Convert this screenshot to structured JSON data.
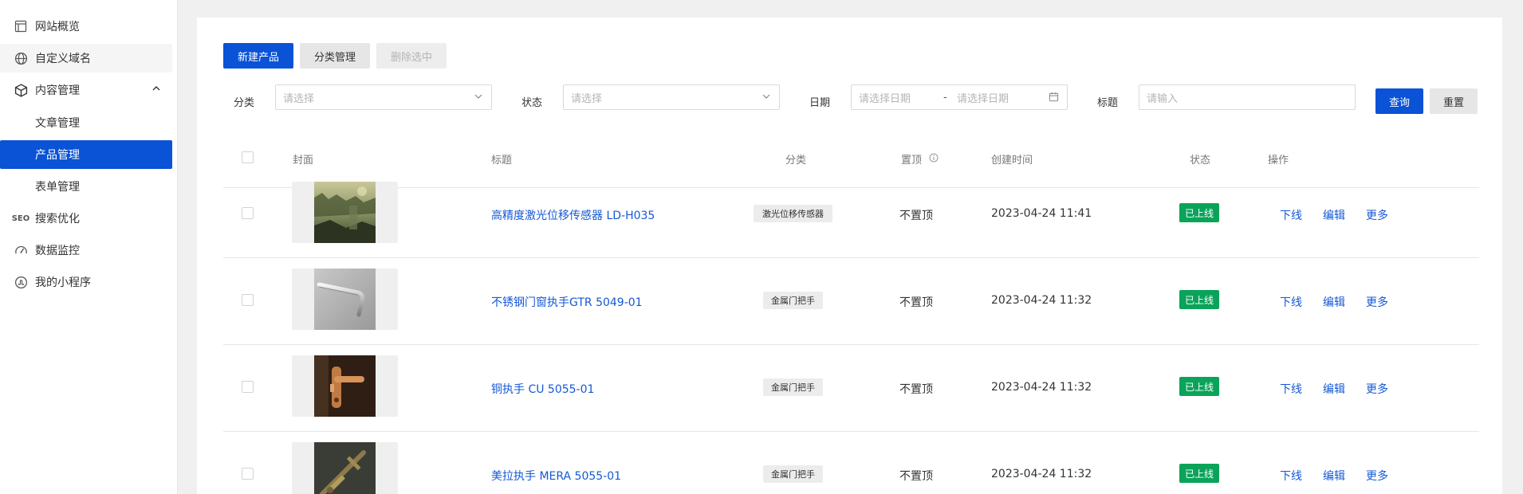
{
  "sidebar": {
    "items": [
      {
        "label": "网站概览"
      },
      {
        "label": "自定义域名"
      },
      {
        "label": "内容管理"
      },
      {
        "label": "文章管理"
      },
      {
        "label": "产品管理"
      },
      {
        "label": "表单管理"
      },
      {
        "label": "搜索优化",
        "icon_text": "SEO"
      },
      {
        "label": "数据监控"
      },
      {
        "label": "我的小程序"
      }
    ],
    "active_color": "#0a52d6"
  },
  "toolbar": {
    "new_label": "新建产品",
    "category_label": "分类管理",
    "delete_label": "删除选中"
  },
  "filters": {
    "category": {
      "label": "分类",
      "placeholder": "请选择"
    },
    "status": {
      "label": "状态",
      "placeholder": "请选择"
    },
    "date": {
      "label": "日期",
      "start_placeholder": "请选择日期",
      "separator": "-",
      "end_placeholder": "请选择日期"
    },
    "title": {
      "label": "标题",
      "placeholder": "请输入"
    },
    "query_label": "查询",
    "reset_label": "重置"
  },
  "table": {
    "headers": {
      "cover": "封面",
      "title": "标题",
      "category": "分类",
      "pin": "置顶",
      "created": "创建时间",
      "status": "状态",
      "actions": "操作"
    },
    "rows": [
      {
        "title": "高精度激光位移传感器 LD-H035",
        "category": "激光位移传感器",
        "pin": "不置顶",
        "created": "2023-04-24 11:41",
        "status": "已上线",
        "thumb": "landscape"
      },
      {
        "title": "不锈钢门窗执手GTR 5049-01",
        "category": "金属门把手",
        "pin": "不置顶",
        "created": "2023-04-24 11:32",
        "status": "已上线",
        "thumb": "steel-handle"
      },
      {
        "title": "铜执手 CU 5055-01",
        "category": "金属门把手",
        "pin": "不置顶",
        "created": "2023-04-24 11:32",
        "status": "已上线",
        "thumb": "copper-handle"
      },
      {
        "title": "美拉执手 MERA 5055-01",
        "category": "金属门把手",
        "pin": "不置顶",
        "created": "2023-04-24 11:32",
        "status": "已上线",
        "thumb": "brass-handle"
      }
    ],
    "actions": {
      "offline": "下线",
      "edit": "编辑",
      "more": "更多"
    }
  },
  "colors": {
    "primary": "#0a52d6",
    "link": "#1558d6",
    "online": "#0aa35a"
  }
}
